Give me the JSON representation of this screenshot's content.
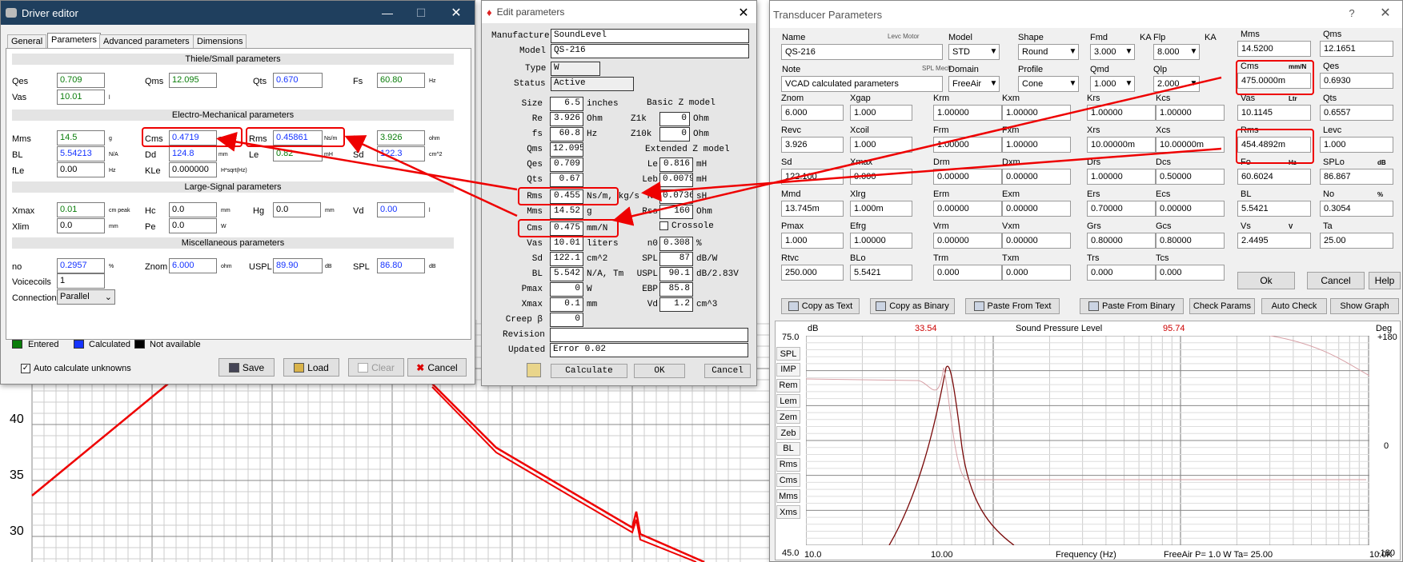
{
  "background": {
    "y_ticks": [
      "40",
      "35",
      "30"
    ]
  },
  "driver_editor": {
    "title": "Driver editor",
    "tabs": [
      "General",
      "Parameters",
      "Advanced parameters",
      "Dimensions"
    ],
    "sections": {
      "ts": "Thiele/Small parameters",
      "em": "Electro-Mechanical parameters",
      "ls": "Large-Signal parameters",
      "misc": "Miscellaneous parameters"
    },
    "qes": {
      "label": "Qes",
      "value": "0.709"
    },
    "qms": {
      "label": "Qms",
      "value": "12.095"
    },
    "qts": {
      "label": "Qts",
      "value": "0.670"
    },
    "fs": {
      "label": "Fs",
      "value": "60.80",
      "unit": "Hz"
    },
    "vas": {
      "label": "Vas",
      "value": "10.01",
      "unit": "l"
    },
    "mms": {
      "label": "Mms",
      "value": "14.5",
      "unit": "g"
    },
    "cms": {
      "label": "Cms",
      "value": "0.4719",
      "unit": "mm/N"
    },
    "rms": {
      "label": "Rms",
      "value": "0.45861",
      "unit": "Ns/m"
    },
    "re": {
      "label": "Re",
      "value": "3.926",
      "unit": "ohm"
    },
    "bl": {
      "label": "BL",
      "value": "5.54213",
      "unit": "N/A"
    },
    "dd": {
      "label": "Dd",
      "value": "124.8",
      "unit": "mm"
    },
    "le": {
      "label": "Le",
      "value": "0.82",
      "unit": "mH"
    },
    "sd": {
      "label": "Sd",
      "value": "122.3",
      "unit": "cm^2"
    },
    "fle": {
      "label": "fLe",
      "value": "0.00",
      "unit": "Hz"
    },
    "kle": {
      "label": "KLe",
      "value": "0.000000",
      "unit": "H*sqrt(Hz)"
    },
    "xmax": {
      "label": "Xmax",
      "value": "0.01",
      "unit": "cm peak"
    },
    "hc": {
      "label": "Hc",
      "value": "0.0",
      "unit": "mm"
    },
    "hg": {
      "label": "Hg",
      "value": "0.0",
      "unit": "mm"
    },
    "vd": {
      "label": "Vd",
      "value": "0.00",
      "unit": "l"
    },
    "xlim": {
      "label": "Xlim",
      "value": "0.0",
      "unit": "mm"
    },
    "pe": {
      "label": "Pe",
      "value": "0.0",
      "unit": "W"
    },
    "no": {
      "label": "no",
      "value": "0.2957",
      "unit": "%"
    },
    "znom": {
      "label": "Znom",
      "value": "6.000",
      "unit": "ohm"
    },
    "uspl": {
      "label": "USPL",
      "value": "89.90",
      "unit": "dB"
    },
    "spl": {
      "label": "SPL",
      "value": "86.80",
      "unit": "dB"
    },
    "voicecoils": {
      "label": "Voicecoils",
      "value": "1"
    },
    "connection": {
      "label": "Connection",
      "value": "Parallel"
    },
    "legend": {
      "entered": "Entered",
      "calculated": "Calculated",
      "na": "Not available",
      "c_entered": "#0a7d0a",
      "c_calc": "#1533ff",
      "c_na": "#000000"
    },
    "auto_calc": "Auto calculate unknowns",
    "buttons": {
      "save": "Save",
      "load": "Load",
      "clear": "Clear",
      "cancel": "Cancel"
    }
  },
  "edit_params": {
    "title": "Edit parameters",
    "manufacturer": {
      "label": "Manufacturer",
      "value": "SoundLevel"
    },
    "model": {
      "label": "Model",
      "value": "QS-216"
    },
    "type": {
      "label": "Type",
      "value": "W"
    },
    "status": {
      "label": "Status",
      "value": "Active"
    },
    "left": [
      {
        "label": "Size",
        "value": "6.5",
        "unit": "inches"
      },
      {
        "label": "Re",
        "value": "3.926",
        "unit": "Ohm"
      },
      {
        "label": "fs",
        "value": "60.8",
        "unit": "Hz"
      },
      {
        "label": "Qms",
        "value": "12.095",
        "unit": ""
      },
      {
        "label": "Qes",
        "value": "0.709",
        "unit": ""
      },
      {
        "label": "Qts",
        "value": "0.67",
        "unit": ""
      },
      {
        "label": "Rms",
        "value": "0.455",
        "unit": "Ns/m, kg/s"
      },
      {
        "label": "Mms",
        "value": "14.52",
        "unit": "g"
      },
      {
        "label": "Cms",
        "value": "0.475",
        "unit": "mm/N"
      },
      {
        "label": "Vas",
        "value": "10.01",
        "unit": "liters"
      },
      {
        "label": "Sd",
        "value": "122.1",
        "unit": "cm^2"
      },
      {
        "label": "BL",
        "value": "5.542",
        "unit": "N/A, Tm"
      },
      {
        "label": "Pmax",
        "value": "0",
        "unit": "W"
      },
      {
        "label": "Xmax",
        "value": "0.1",
        "unit": "mm"
      },
      {
        "label": "Creep β",
        "value": "0",
        "unit": ""
      }
    ],
    "basic_z": "Basic Z model",
    "ext_z": "Extended Z model",
    "z1k": {
      "label": "Z1k",
      "value": "0",
      "unit": "Ohm"
    },
    "z10k": {
      "label": "Z10k",
      "value": "0",
      "unit": "Ohm"
    },
    "le": {
      "label": "Le",
      "value": "0.816",
      "unit": "mH"
    },
    "leb": {
      "label": "Leb",
      "value": "0.00791",
      "unit": "mH"
    },
    "ke": {
      "label": "Ke",
      "value": "0.0736",
      "unit": "sH"
    },
    "rss": {
      "label": "Rss",
      "value": "160",
      "unit": "Ohm"
    },
    "crossover": "Crossole",
    "n0": {
      "label": "n0",
      "value": "0.308",
      "unit": "%"
    },
    "spl": {
      "label": "SPL",
      "value": "87",
      "unit": "dB/W"
    },
    "uspl": {
      "label": "USPL",
      "value": "90.1",
      "unit": "dB/2.83V"
    },
    "ebp": {
      "label": "EBP",
      "value": "85.8",
      "unit": ""
    },
    "vd": {
      "label": "Vd",
      "value": "1.2",
      "unit": "cm^3"
    },
    "revision": {
      "label": "Revision",
      "value": ""
    },
    "updated": {
      "label": "Updated",
      "value": "Error 0.02"
    },
    "buttons": {
      "calculate": "Calculate",
      "ok": "OK",
      "cancel": "Cancel"
    }
  },
  "transducer": {
    "title": "Transducer Parameters",
    "name": {
      "label": "Name",
      "tag": "Levc Motor",
      "value": "QS-216"
    },
    "note": {
      "label": "Note",
      "tag": "SPL Mech",
      "value": "VCAD calculated parameters"
    },
    "model": {
      "label": "Model",
      "value": "STD"
    },
    "shape": {
      "label": "Shape",
      "value": "Round"
    },
    "fmd": {
      "label": "Fmd",
      "unit": "KA",
      "value": "3.000"
    },
    "flp": {
      "label": "Flp",
      "unit": "KA",
      "value": "8.000"
    },
    "domain": {
      "label": "Domain",
      "value": "FreeAir"
    },
    "profile": {
      "label": "Profile",
      "value": "Cone"
    },
    "qmd": {
      "label": "Qmd",
      "value": "1.000"
    },
    "qlp": {
      "label": "Qlp",
      "value": "2.000"
    },
    "grid": [
      [
        {
          "label": "Znom",
          "value": "6.000"
        },
        {
          "label": "Xgap",
          "value": "1.000"
        },
        {
          "label": "Krm",
          "value": "1.00000"
        },
        {
          "label": "Kxm",
          "value": "1.00000"
        },
        {
          "label": "Krs",
          "value": "1.00000"
        },
        {
          "label": "Kcs",
          "value": "1.00000"
        }
      ],
      [
        {
          "label": "Revc",
          "value": "3.926"
        },
        {
          "label": "Xcoil",
          "value": "1.000"
        },
        {
          "label": "Frm",
          "value": "1.00000"
        },
        {
          "label": "Fxm",
          "value": "1.00000"
        },
        {
          "label": "Xrs",
          "value": "10.00000m"
        },
        {
          "label": "Xcs",
          "value": "10.00000m"
        }
      ],
      [
        {
          "label": "Sd",
          "value": "122.100"
        },
        {
          "label": "Xmax",
          "value": "0.000"
        },
        {
          "label": "Drm",
          "value": "0.00000"
        },
        {
          "label": "Dxm",
          "value": "0.00000"
        },
        {
          "label": "Drs",
          "value": "1.00000"
        },
        {
          "label": "Dcs",
          "value": "0.50000"
        }
      ],
      [
        {
          "label": "Mmd",
          "value": "13.745m"
        },
        {
          "label": "Xlrg",
          "value": "1.000m"
        },
        {
          "label": "Erm",
          "value": "0.00000"
        },
        {
          "label": "Exm",
          "value": "0.00000"
        },
        {
          "label": "Ers",
          "value": "0.70000"
        },
        {
          "label": "Ecs",
          "value": "0.00000"
        }
      ],
      [
        {
          "label": "Pmax",
          "value": "1.000"
        },
        {
          "label": "Efrg",
          "value": "1.00000"
        },
        {
          "label": "Vrm",
          "value": "0.00000"
        },
        {
          "label": "Vxm",
          "value": "0.00000"
        },
        {
          "label": "Grs",
          "value": "0.80000"
        },
        {
          "label": "Gcs",
          "value": "0.80000"
        }
      ],
      [
        {
          "label": "Rtvc",
          "value": "250.000"
        },
        {
          "label": "BLo",
          "value": "5.5421"
        },
        {
          "label": "Trm",
          "value": "0.000"
        },
        {
          "label": "Txm",
          "value": "0.000"
        },
        {
          "label": "Trs",
          "value": "0.000"
        },
        {
          "label": "Tcs",
          "value": "0.000"
        }
      ]
    ],
    "right": [
      {
        "label": "Mms",
        "value": "14.5200"
      },
      {
        "label": "Qms",
        "value": "12.1651"
      },
      {
        "label": "Cms",
        "value": "475.0000m",
        "unit": "mm/N"
      },
      {
        "label": "Qes",
        "value": "0.6930"
      },
      {
        "label": "Vas",
        "value": "10.1145",
        "unit": "Ltr"
      },
      {
        "label": "Qts",
        "value": "0.6557"
      },
      {
        "label": "Rms",
        "value": "454.4892m"
      },
      {
        "label": "Levc",
        "value": "1.000"
      },
      {
        "label": "Fo",
        "value": "60.6024",
        "unit": "Hz"
      },
      {
        "label": "SPLo",
        "value": "86.867",
        "unit": "dB"
      },
      {
        "label": "BL",
        "value": "5.5421"
      },
      {
        "label": "No",
        "value": "0.3054",
        "unit": "%"
      },
      {
        "label": "Vs",
        "value": "2.4495",
        "unit": "V"
      },
      {
        "label": "Ta",
        "value": "25.00"
      }
    ],
    "buttons": {
      "ok": "Ok",
      "cancel": "Cancel",
      "help": "Help",
      "copy_text": "Copy as Text",
      "copy_binary": "Copy as Binary",
      "paste_text": "Paste From Text",
      "paste_binary": "Paste From Binary",
      "check": "Check Params",
      "auto": "Auto Check",
      "graph": "Show Graph"
    },
    "graph": {
      "unit_left": "dB",
      "marker1": "33.54",
      "title": "Sound Pressure Level",
      "marker2": "95.74",
      "unit_right": "Deg",
      "y_top": "75.0",
      "y_bottom": "45.0",
      "yr_top": "+180",
      "yr_mid": "0",
      "yr_bottom": "-180",
      "x_left": "10.0",
      "x_mid": "10.00",
      "x_label": "Frequency (Hz)",
      "x_right": "10.0K",
      "footer": "FreeAir  P= 1.0 W  Ta= 25.00",
      "side_buttons": [
        "SPL",
        "IMP",
        "Rem",
        "Lem",
        "Zem",
        "Zeb",
        "BL",
        "Rms",
        "Cms",
        "Mms",
        "Xms"
      ]
    }
  }
}
